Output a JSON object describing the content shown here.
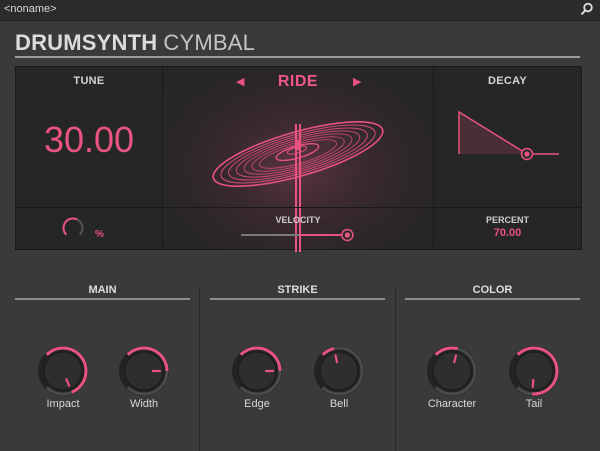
{
  "window": {
    "preset_name": "<noname>",
    "search_icon": "search-icon"
  },
  "header": {
    "title_bold": "DRUMSYNTH",
    "title_light": "CYMBAL"
  },
  "tune": {
    "label": "TUNE",
    "value": "30.00",
    "unit": "%",
    "dial_fraction": 0.6
  },
  "cymbal": {
    "type": "RIDE",
    "velocity_label": "VELOCITY",
    "velocity_fraction": 0.95
  },
  "decay": {
    "label": "DECAY",
    "percent_label": "PERCENT",
    "percent_value": "70.00"
  },
  "groups": [
    {
      "label": "MAIN",
      "knobs": [
        {
          "label": "Impact",
          "value": 0.75
        },
        {
          "label": "Width",
          "value": 0.5
        }
      ]
    },
    {
      "label": "STRIKE",
      "knobs": [
        {
          "label": "Edge",
          "value": 0.5
        },
        {
          "label": "Bell",
          "value": 0.12
        }
      ]
    },
    {
      "label": "COLOR",
      "knobs": [
        {
          "label": "Character",
          "value": 0.22
        },
        {
          "label": "Tail",
          "value": 0.85
        }
      ]
    }
  ],
  "colors": {
    "accent": "#e8537f",
    "panel": "#262626",
    "background": "#3a3a3a"
  }
}
